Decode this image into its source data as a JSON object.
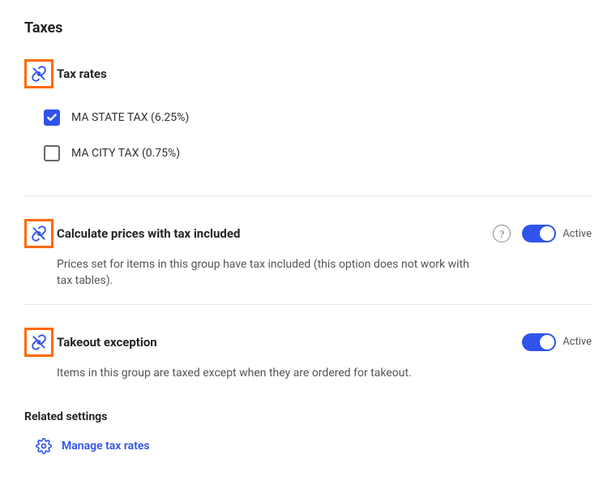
{
  "page_title": "Taxes",
  "tax_rates": {
    "title": "Tax rates",
    "items": [
      {
        "label": "MA STATE TAX (6.25%)",
        "checked": true
      },
      {
        "label": "MA CITY TAX (0.75%)",
        "checked": false
      }
    ]
  },
  "tax_included": {
    "title": "Calculate prices with tax included",
    "description": "Prices set for items in this group have tax included (this option does not work with tax tables).",
    "toggle_state": "Active"
  },
  "takeout_exception": {
    "title": "Takeout exception",
    "description": "Items in this group are taxed except when they are ordered for takeout.",
    "toggle_state": "Active"
  },
  "related": {
    "title": "Related settings",
    "manage_link": "Manage tax rates"
  }
}
